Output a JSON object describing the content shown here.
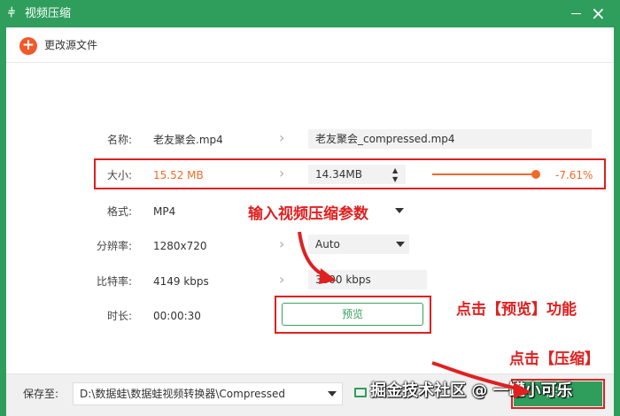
{
  "window": {
    "title": "视频压缩",
    "app_icon": "equalizer-icon"
  },
  "toolbar": {
    "change_source_label": "更改源文件"
  },
  "rows": {
    "name": {
      "label": "名称:",
      "value": "老友聚会.mp4",
      "output": "老友聚会_compressed.mp4"
    },
    "size": {
      "label": "大小:",
      "value": "15.52 MB",
      "output": "14.34MB",
      "percent": "-7.61%",
      "slider_fraction": 0.96
    },
    "format": {
      "label": "格式:",
      "value": "MP4"
    },
    "resolution": {
      "label": "分辨率:",
      "value": "1280x720",
      "output": "Auto"
    },
    "bitrate": {
      "label": "比特率:",
      "value": "4149 kbps",
      "output": "3800 kbps"
    },
    "duration": {
      "label": "时长:",
      "value": "00:00:30"
    }
  },
  "preview_button": "预览",
  "annotations": {
    "input_params": "输入视频压缩参数",
    "click_preview": "点击【预览】功能",
    "click_compress": "点击【压缩】"
  },
  "bottom": {
    "save_label": "保存至:",
    "save_path": "D:\\数据蛙\\数据蛙视频转换器\\Compressed",
    "compress_button": "压缩",
    "watermark": "掘金技术社区 @ 一罐小可乐"
  },
  "colors": {
    "brand_green": "#2f9e5c",
    "accent_orange": "#f06a2a",
    "annotation_red": "#e02020"
  }
}
